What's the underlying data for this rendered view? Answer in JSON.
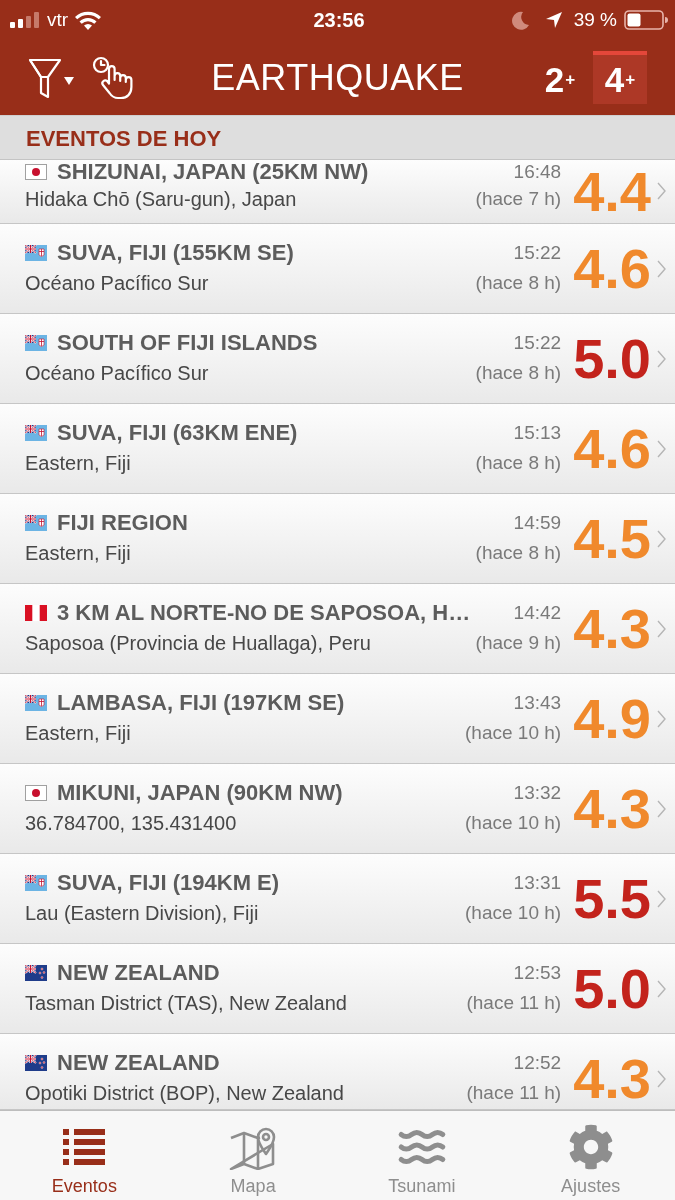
{
  "status_bar": {
    "carrier": "vtr",
    "time": "23:56",
    "battery": "39 %"
  },
  "nav_bar": {
    "title": "EARTHQUAKE",
    "magnitude_filters": [
      {
        "label": "2$^{+}$",
        "selected": false
      },
      {
        "label": "4$^{+}$",
        "selected": true
      }
    ]
  },
  "section_header": "EVENTOS DE HOY",
  "events": [
    {
      "kind": "japan",
      "title": "SHIZUNAI, JAPAN (25KM NW)",
      "place": "Hidaka Chō (Saru-gun), Japan",
      "time": "16:48",
      "ago": "(hace 7 h)",
      "magnitude": "4.4",
      "color": "#f0892c"
    },
    {
      "kind": "fiji",
      "title": "SUVA, FIJI (155KM SE)",
      "place": "Océano Pacífico Sur",
      "time": "15:22",
      "ago": "(hace 8 h)",
      "magnitude": "4.6",
      "color": "#f0892c"
    },
    {
      "kind": "fiji",
      "title": "SOUTH OF FIJI ISLANDS",
      "place": "Océano Pacífico Sur",
      "time": "15:22",
      "ago": "(hace 8 h)",
      "magnitude": "5.0",
      "color": "#c3231c"
    },
    {
      "kind": "fiji",
      "title": "SUVA, FIJI (63KM ENE)",
      "place": "Eastern, Fiji",
      "time": "15:13",
      "ago": "(hace 8 h)",
      "magnitude": "4.6",
      "color": "#f0892c"
    },
    {
      "kind": "fiji",
      "title": "FIJI REGION",
      "place": "Eastern, Fiji",
      "time": "14:59",
      "ago": "(hace 8 h)",
      "magnitude": "4.5",
      "color": "#f0892c"
    },
    {
      "kind": "peru",
      "title": "3 KM AL NORTE-NO DE SAPOSOA, H…",
      "place": "Saposoa (Provincia de Huallaga), Peru",
      "time": "14:42",
      "ago": "(hace 9 h)",
      "magnitude": "4.3",
      "color": "#f0892c"
    },
    {
      "kind": "fiji",
      "title": "LAMBASA, FIJI (197KM SE)",
      "place": "Eastern, Fiji",
      "time": "13:43",
      "ago": "(hace 10 h)",
      "magnitude": "4.9",
      "color": "#f0892c"
    },
    {
      "kind": "japan",
      "title": "MIKUNI, JAPAN (90KM NW)",
      "place": "36.784700, 135.431400",
      "time": "13:32",
      "ago": "(hace 10 h)",
      "magnitude": "4.3",
      "color": "#f0892c"
    },
    {
      "kind": "fiji",
      "title": "SUVA, FIJI (194KM E)",
      "place": "Lau (Eastern Division), Fiji",
      "time": "13:31",
      "ago": "(hace 10 h)",
      "magnitude": "5.5",
      "color": "#c3231c"
    },
    {
      "kind": "newzealand",
      "title": "NEW ZEALAND",
      "place": "Tasman District (TAS), New Zealand",
      "time": "12:53",
      "ago": "(hace 11 h)",
      "magnitude": "5.0",
      "color": "#c3231c"
    },
    {
      "kind": "newzealand",
      "title": "NEW ZEALAND",
      "place": "Opotiki District (BOP), New Zealand",
      "time": "12:52",
      "ago": "(hace 11 h)",
      "magnitude": "4.3",
      "color": "#f0892c"
    }
  ],
  "tab_bar": [
    {
      "label": "Eventos",
      "selected": true
    },
    {
      "label": "Mapa",
      "selected": false
    },
    {
      "label": "Tsunami",
      "selected": false
    },
    {
      "label": "Ajustes",
      "selected": false
    }
  ]
}
